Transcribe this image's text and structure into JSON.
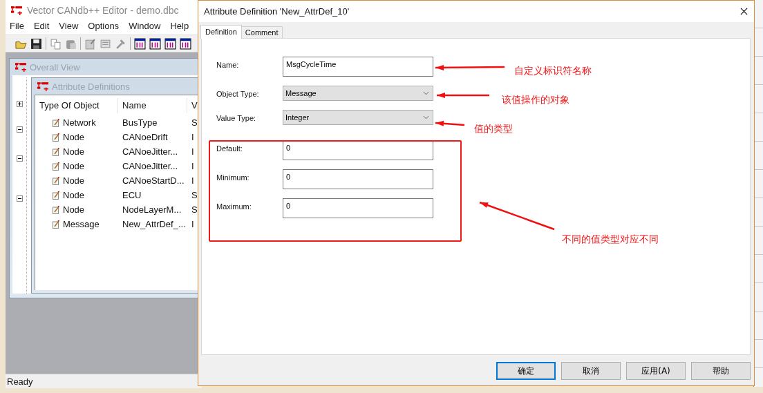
{
  "main_window": {
    "title": "Vector CANdb++ Editor - demo.dbc",
    "menu": [
      "File",
      "Edit",
      "View",
      "Options",
      "Window",
      "Help"
    ],
    "overall_view": {
      "title": "Overall View",
      "tree_nodes": [
        {
          "expanded": false
        },
        {
          "expanded": true
        },
        {
          "expanded": true
        },
        {
          "expanded": true
        }
      ]
    },
    "attribute_definitions": {
      "title": "Attribute Definitions",
      "columns": [
        "Type Of Object",
        "Name",
        "V"
      ],
      "rows": [
        {
          "type": "Network",
          "name": "BusType",
          "column_3": "S"
        },
        {
          "type": "Node",
          "name": "CANoeDrift",
          "column_3": "I"
        },
        {
          "type": "Node",
          "name": "CANoeJitter...",
          "column_3": "I"
        },
        {
          "type": "Node",
          "name": "CANoeJitter...",
          "column_3": "I"
        },
        {
          "type": "Node",
          "name": "CANoeStartD...",
          "column_3": "I"
        },
        {
          "type": "Node",
          "name": "ECU",
          "column_3": "S"
        },
        {
          "type": "Node",
          "name": "NodeLayerM...",
          "column_3": "S"
        },
        {
          "type": "Message",
          "name": "New_AttrDef_...",
          "column_3": "I"
        }
      ]
    },
    "status_bar": "Ready"
  },
  "dialog": {
    "title": "Attribute Definition 'New_AttrDef_10'",
    "tabs": [
      {
        "label": "Definition",
        "selected": true
      },
      {
        "label": "Comment",
        "selected": false
      }
    ],
    "fields": [
      {
        "label": "Name:",
        "kind": "text",
        "value": "MsgCycleTime"
      },
      {
        "label": "Object Type:",
        "kind": "select",
        "value": "Message"
      },
      {
        "label": "Value Type:",
        "kind": "select",
        "value": "Integer"
      },
      {
        "label": "Default:",
        "kind": "text",
        "value": "0"
      },
      {
        "label": "Minimum:",
        "kind": "text",
        "value": "0"
      },
      {
        "label": "Maximum:",
        "kind": "text",
        "value": "0"
      }
    ],
    "buttons": [
      {
        "label": "确定",
        "default": true
      },
      {
        "label": "取消",
        "default": false
      },
      {
        "label": "应用(A)",
        "default": false
      },
      {
        "label": "帮助",
        "default": false
      }
    ]
  },
  "annotations": [
    "自定义标识符名称",
    "该值操作的对象",
    "值的类型",
    "不同的值类型对应不同"
  ]
}
